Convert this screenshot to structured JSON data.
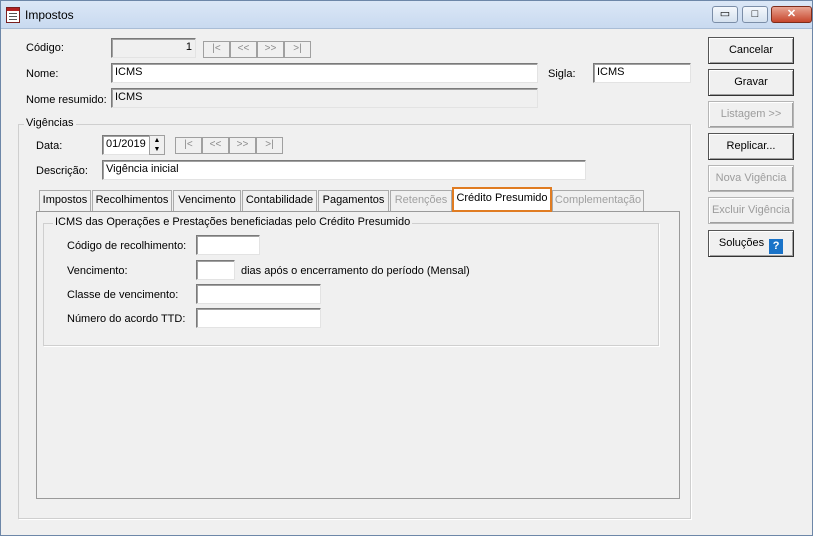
{
  "window": {
    "title": "Impostos",
    "controls": {
      "minimize": "▭",
      "maximize": "□",
      "close": "✕"
    }
  },
  "form": {
    "codigo_label": "Código:",
    "codigo_value": "1",
    "nome_label": "Nome:",
    "nome_value": "ICMS",
    "sigla_label": "Sigla:",
    "sigla_value": "ICMS",
    "nome_resumido_label": "Nome resumido:",
    "nome_resumido_value": "ICMS"
  },
  "nav": {
    "first": "|<",
    "prev": "<<",
    "next": ">>",
    "last": ">|"
  },
  "vigencias": {
    "title": "Vigências",
    "data_label": "Data:",
    "data_value": "01/2019",
    "descricao_label": "Descrição:",
    "descricao_value": "Vigência inicial"
  },
  "tabs": [
    {
      "label": "Impostos",
      "enabled": true
    },
    {
      "label": "Recolhimentos",
      "enabled": true
    },
    {
      "label": "Vencimento",
      "enabled": true
    },
    {
      "label": "Contabilidade",
      "enabled": true
    },
    {
      "label": "Pagamentos",
      "enabled": true
    },
    {
      "label": "Retenções",
      "enabled": false
    },
    {
      "label": "Crédito Presumido",
      "enabled": true,
      "active": true
    },
    {
      "label": "Complementação",
      "enabled": false
    }
  ],
  "credito_presumido": {
    "group_title": "ICMS das Operações e Prestações beneficiadas pelo Crédito Presumido",
    "codigo_recolhimento_label": "Código de recolhimento:",
    "codigo_recolhimento_value": "",
    "vencimento_label": "Vencimento:",
    "vencimento_value": "",
    "vencimento_suffix": "dias após o encerramento do período (Mensal)",
    "classe_vencimento_label": "Classe de vencimento:",
    "classe_vencimento_value": "",
    "numero_acordo_label": "Número do acordo TTD:",
    "numero_acordo_value": ""
  },
  "buttons": {
    "cancelar": "Cancelar",
    "gravar": "Gravar",
    "listagem": "Listagem >>",
    "replicar": "Replicar...",
    "nova_vigencia": "Nova Vigência",
    "excluir_vigencia": "Excluir Vigência",
    "solucoes": "Soluções",
    "help_icon": "?"
  },
  "colors": {
    "active_tab_border": "#e07c22",
    "help_icon": "#1a73c8"
  }
}
